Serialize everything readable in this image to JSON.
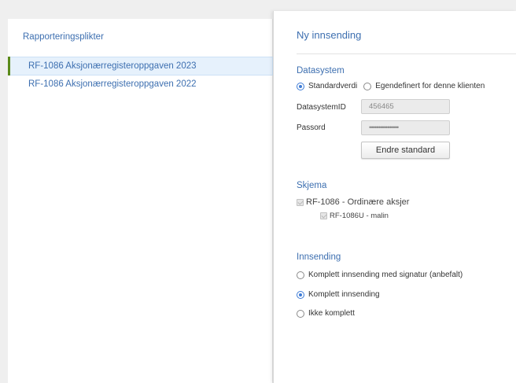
{
  "left_panel": {
    "heading": "Rapporteringsplikter",
    "items": [
      {
        "label": "RF-1086 Aksjonærregisteroppgaven 2023",
        "selected": true
      },
      {
        "label": "RF-1086 Aksjonærregisteroppgaven 2022",
        "selected": false
      }
    ]
  },
  "right_panel": {
    "title": "Ny innsending",
    "datasystem": {
      "section_title": "Datasystem",
      "option_standard": "Standardverdi",
      "option_custom": "Egendefinert for denne klienten",
      "selected": "standard",
      "id_label": "DatasystemID",
      "id_value": "456465",
      "password_label": "Passord",
      "password_value": "••••••••••••••••",
      "change_button": "Endre standard"
    },
    "skjema": {
      "section_title": "Skjema",
      "main_form": "RF-1086 - Ordinære aksjer",
      "sub_form": "RF-1086U - malin"
    },
    "innsending": {
      "section_title": "Innsending",
      "options": [
        {
          "label": "Komplett innsending med signatur (anbefalt)",
          "checked": false
        },
        {
          "label": "Komplett innsending",
          "checked": true
        },
        {
          "label": "Ikke komplett",
          "checked": false
        }
      ]
    }
  },
  "colors": {
    "accent_blue": "#3d6fb0",
    "selection_bar": "#5a8a1a",
    "selected_bg": "#e6f1fc",
    "radio_checked": "#3d7bd6"
  }
}
